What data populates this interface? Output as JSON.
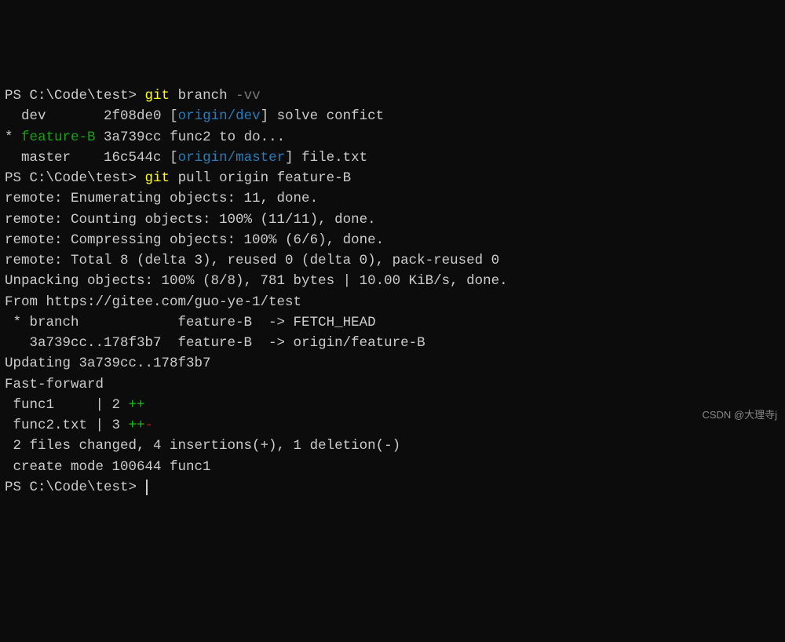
{
  "prompt": "PS C:\\Code\\test>",
  "cmd1": {
    "git": "git",
    "args": "branch",
    "flag": "-vv"
  },
  "branch1": {
    "indent": "  ",
    "name": "dev",
    "pad": "       ",
    "hash": "2f08de0",
    "lb": " [",
    "origin": "origin/dev",
    "rb": "]",
    "msg": " solve confict"
  },
  "branch2": {
    "star": "* ",
    "name": "feature-B",
    "pad": " ",
    "hash": "3a739cc",
    "msg": " func2 to do..."
  },
  "branch3": {
    "indent": "  ",
    "name": "master",
    "pad": "    ",
    "hash": "16c544c",
    "lb": " [",
    "origin": "origin/master",
    "rb": "]",
    "msg": " file.txt"
  },
  "cmd2": {
    "git": "git",
    "args": " pull origin feature-B"
  },
  "remote_enum": "remote: Enumerating objects: 11, done.",
  "remote_count": "remote: Counting objects: 100% (11/11), done.",
  "remote_compress": "remote: Compressing objects: 100% (6/6), done.",
  "remote_total": "remote: Total 8 (delta 3), reused 0 (delta 0), pack-reused 0",
  "unpack": "Unpacking objects: 100% (8/8), 781 bytes | 10.00 KiB/s, done.",
  "from": "From https://gitee.com/guo-ye-1/test",
  "fetch1": " * branch            feature-B  -> FETCH_HEAD",
  "fetch2": "   3a739cc..178f3b7  feature-B  -> origin/feature-B",
  "updating": "Updating 3a739cc..178f3b7",
  "ff": "Fast-forward",
  "diff1": {
    "file": " func1     | 2 ",
    "plus": "++"
  },
  "diff2": {
    "file": " func2.txt | 3 ",
    "plus": "++",
    "minus": "-"
  },
  "summary": " 2 files changed, 4 insertions(+), 1 deletion(-)",
  "create": " create mode 100644 func1",
  "watermark": "CSDN @大理寺j"
}
